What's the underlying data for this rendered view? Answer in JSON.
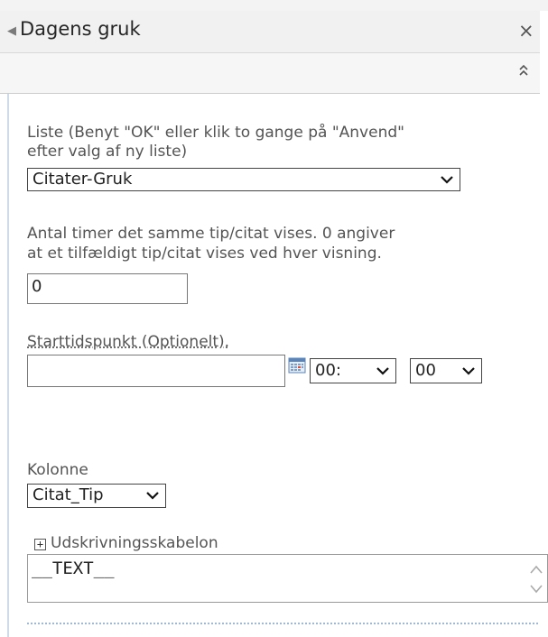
{
  "panel": {
    "title": "Dagens gruk",
    "close_glyph": "×"
  },
  "list_section": {
    "label_line1": "Liste (Benyt \"OK\" eller klik to gange på \"Anvend\"",
    "label_line2": "efter valg af ny liste)",
    "selected_list": "Citater-Gruk"
  },
  "hours_section": {
    "label_line1": "Antal timer det samme tip/citat vises. 0 angiver",
    "label_line2": "at et tilfældigt tip/citat vises ved hver visning.",
    "value": "0"
  },
  "start_section": {
    "label": "Starttidspunkt (Optionelt).",
    "date_value": "",
    "hour_value": "00:",
    "minute_value": "00"
  },
  "column_section": {
    "label": "Kolonne",
    "selected_column": "Citat_Tip"
  },
  "template_section": {
    "expand_glyph": "+",
    "label": "Udskrivningsskabelon",
    "value": "__TEXT__"
  },
  "icons": {
    "collapse": "double-chevron-up-icon",
    "calendar": "calendar-icon",
    "dropdown": "chevron-down-icon",
    "panel_arrow": "triangle-left-icon"
  }
}
